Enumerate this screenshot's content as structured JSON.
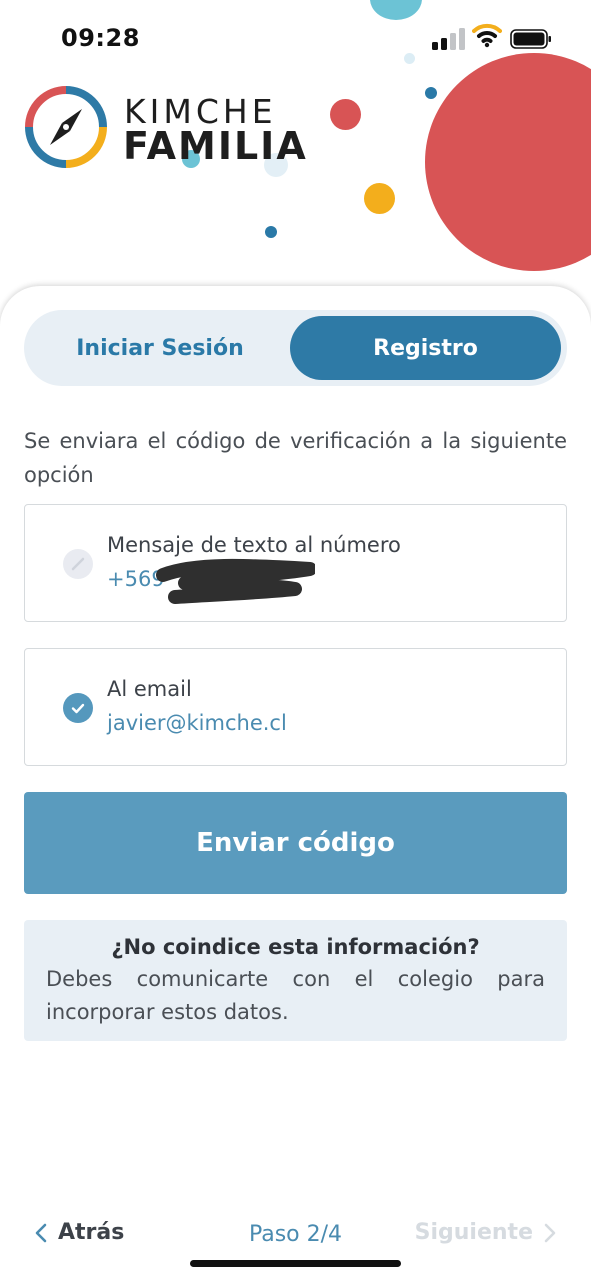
{
  "status_bar": {
    "time": "09:28"
  },
  "brand": {
    "line1": "KIMCHE",
    "line2": "FAMILIA"
  },
  "tabs": [
    {
      "label": "Iniciar Sesión",
      "active": false
    },
    {
      "label": "Registro",
      "active": true
    }
  ],
  "intro_text": "Se enviara el código de verificación a la siguiente opción",
  "options": {
    "sms": {
      "label": "Mensaje de texto al número",
      "value": "+569",
      "selected": false
    },
    "email": {
      "label": "Al email",
      "value": "javier@kimche.cl",
      "selected": true
    }
  },
  "send_button_label": "Enviar código",
  "info": {
    "title": "¿No coindice esta información?",
    "text": "Debes comunicarte con el colegio para incorporar estos datos."
  },
  "footer": {
    "back_label": "Atrás",
    "step_label": "Paso 2/4",
    "next_label": "Siguiente"
  },
  "colors": {
    "primary": "#2e7aa6",
    "button": "#5a9bbe",
    "accent_red": "#d85455",
    "accent_yellow": "#f3ae1c",
    "accent_cyan": "#6cc3d5"
  }
}
